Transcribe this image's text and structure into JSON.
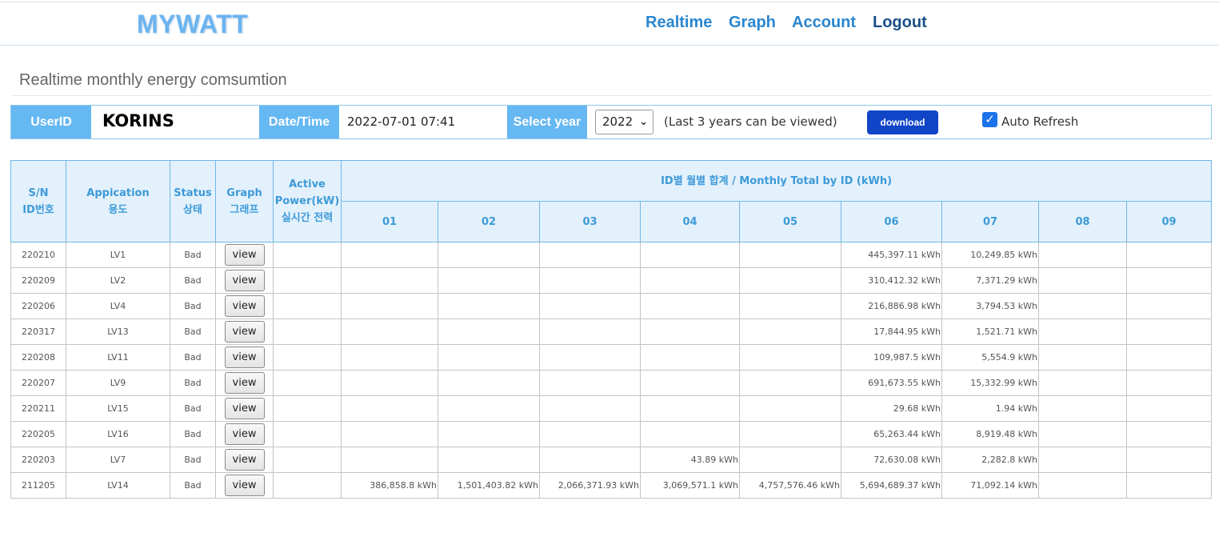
{
  "header": {
    "logo": "MYWATT",
    "nav": [
      {
        "label": "Realtime"
      },
      {
        "label": "Graph"
      },
      {
        "label": "Account"
      },
      {
        "label": "Logout"
      }
    ]
  },
  "page_title": "Realtime monthly energy comsumtion",
  "info": {
    "user_label": "UserID",
    "user_value": "KORINS",
    "date_label": "Date/Time",
    "date_value": "2022-07-01 07:41",
    "year_label": "Select year",
    "year_value": "2022",
    "note": "(Last 3 years can be viewed)",
    "download_label": "download",
    "auto_refresh_label": "Auto Refresh",
    "auto_refresh_checked": true
  },
  "table": {
    "h_sn": "S/N",
    "h_sn2": "ID번호",
    "h_app": "Appication",
    "h_app2": "용도",
    "h_status": "Status",
    "h_status2": "상태",
    "h_graph": "Graph",
    "h_graph2": "그래프",
    "h_power": "Active",
    "h_power2": "Power(kW)",
    "h_power3": "실시간 전력",
    "h_monthly": "ID별 월별 합계 / Monthly Total by ID (kWh)",
    "months": [
      "01",
      "02",
      "03",
      "04",
      "05",
      "06",
      "07",
      "08",
      "09"
    ],
    "view_label": "view",
    "rows": [
      {
        "sn": "220210",
        "app": "LV1",
        "status": "Bad",
        "power": "",
        "m": [
          "",
          "",
          "",
          "",
          "",
          "445,397.11 kWh",
          "10,249.85 kWh",
          "",
          ""
        ]
      },
      {
        "sn": "220209",
        "app": "LV2",
        "status": "Bad",
        "power": "",
        "m": [
          "",
          "",
          "",
          "",
          "",
          "310,412.32 kWh",
          "7,371.29 kWh",
          "",
          ""
        ]
      },
      {
        "sn": "220206",
        "app": "LV4",
        "status": "Bad",
        "power": "",
        "m": [
          "",
          "",
          "",
          "",
          "",
          "216,886.98 kWh",
          "3,794.53 kWh",
          "",
          ""
        ]
      },
      {
        "sn": "220317",
        "app": "LV13",
        "status": "Bad",
        "power": "",
        "m": [
          "",
          "",
          "",
          "",
          "",
          "17,844.95 kWh",
          "1,521.71 kWh",
          "",
          ""
        ]
      },
      {
        "sn": "220208",
        "app": "LV11",
        "status": "Bad",
        "power": "",
        "m": [
          "",
          "",
          "",
          "",
          "",
          "109,987.5 kWh",
          "5,554.9 kWh",
          "",
          ""
        ]
      },
      {
        "sn": "220207",
        "app": "LV9",
        "status": "Bad",
        "power": "",
        "m": [
          "",
          "",
          "",
          "",
          "",
          "691,673.55 kWh",
          "15,332.99 kWh",
          "",
          ""
        ]
      },
      {
        "sn": "220211",
        "app": "LV15",
        "status": "Bad",
        "power": "",
        "m": [
          "",
          "",
          "",
          "",
          "",
          "29.68 kWh",
          "1.94 kWh",
          "",
          ""
        ]
      },
      {
        "sn": "220205",
        "app": "LV16",
        "status": "Bad",
        "power": "",
        "m": [
          "",
          "",
          "",
          "",
          "",
          "65,263.44 kWh",
          "8,919.48 kWh",
          "",
          ""
        ]
      },
      {
        "sn": "220203",
        "app": "LV7",
        "status": "Bad",
        "power": "",
        "m": [
          "",
          "",
          "",
          "43.89 kWh",
          "",
          "72,630.08 kWh",
          "2,282.8 kWh",
          "",
          ""
        ]
      },
      {
        "sn": "211205",
        "app": "LV14",
        "status": "Bad",
        "power": "",
        "m": [
          "386,858.8 kWh",
          "1,501,403.82 kWh",
          "2,066,371.93 kWh",
          "3,069,571.1 kWh",
          "4,757,576.46 kWh",
          "5,694,689.37 kWh",
          "71,092.14 kWh",
          "",
          ""
        ]
      }
    ]
  }
}
